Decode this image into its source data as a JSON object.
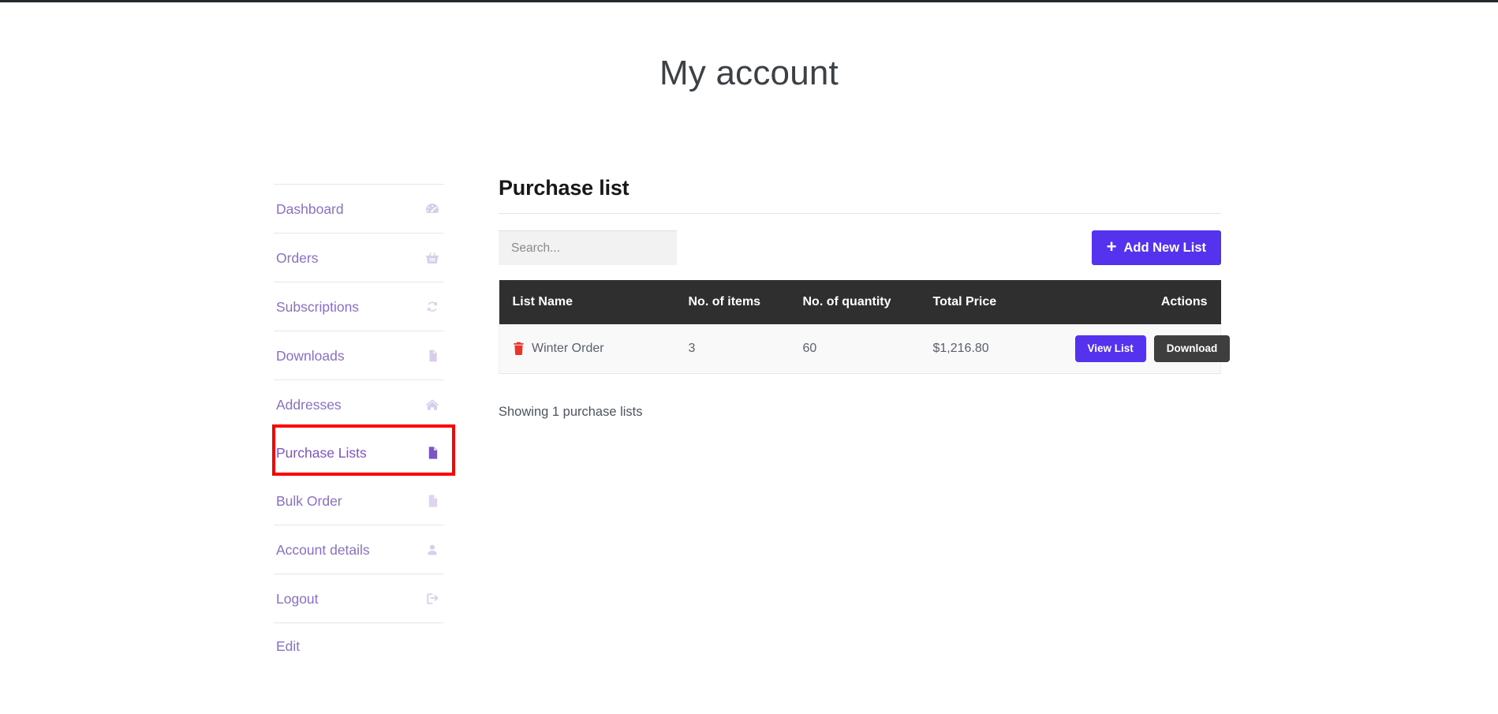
{
  "page": {
    "title": "My account"
  },
  "sidebar": {
    "items": [
      {
        "label": "Dashboard",
        "icon": "dashboard-gauge-icon",
        "active": false
      },
      {
        "label": "Orders",
        "icon": "basket-icon",
        "active": false
      },
      {
        "label": "Subscriptions",
        "icon": "refresh-cycle-icon",
        "active": false
      },
      {
        "label": "Downloads",
        "icon": "download-file-icon",
        "active": false
      },
      {
        "label": "Addresses",
        "icon": "home-icon",
        "active": false
      },
      {
        "label": "Purchase Lists",
        "icon": "document-list-icon",
        "active": true
      },
      {
        "label": "Bulk Order",
        "icon": "document-list-icon",
        "active": false
      },
      {
        "label": "Account details",
        "icon": "user-icon",
        "active": false
      },
      {
        "label": "Logout",
        "icon": "logout-icon",
        "active": false
      },
      {
        "label": "Edit",
        "icon": "",
        "active": false
      }
    ],
    "highlight": {
      "target_label": "Purchase Lists",
      "color": "#ff0000"
    }
  },
  "main": {
    "heading": "Purchase list",
    "toolbar": {
      "search_placeholder": "Search...",
      "search_value": "",
      "add_button_label": "Add New List",
      "add_button_icon": "plus-icon",
      "add_button_color": "#5533ee"
    },
    "table": {
      "columns": [
        "List Name",
        "No. of items",
        "No. of quantity",
        "Total Price",
        "Actions"
      ],
      "header_bg": "#2f2f2f",
      "rows": [
        {
          "delete_icon": "trash-icon",
          "list_name": "Winter Order",
          "items": "3",
          "quantity": "60",
          "total_price": "$1,216.80",
          "view_label": "View List",
          "download_label": "Download"
        }
      ]
    },
    "footer_text": "Showing 1 purchase lists"
  }
}
